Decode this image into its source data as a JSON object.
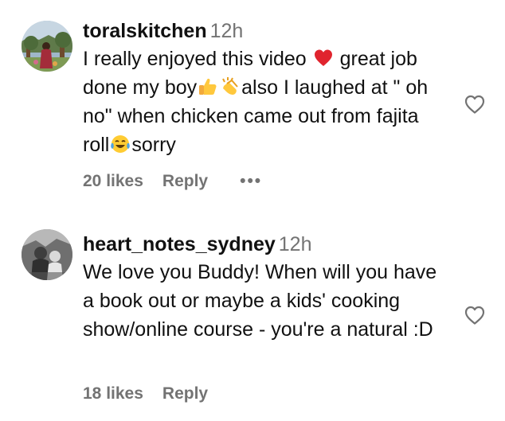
{
  "comments": [
    {
      "username": "toralskitchen",
      "time": "12h",
      "text_parts": [
        "I really enjoyed this video ",
        " great job done my boy",
        "",
        "also I laughed at \" oh no\" when chicken came out from fajita roll",
        "sorry"
      ],
      "likes": "20 likes",
      "reply": "Reply",
      "more": "•••"
    },
    {
      "username": "heart_notes_sydney",
      "time": "12h",
      "text": "We love you Buddy! When will you have a book out or maybe a kids' cooking show/online course - you're a natural :D",
      "likes": "18 likes",
      "reply": "Reply"
    }
  ],
  "icons": {
    "like": "heart-outline-icon",
    "emoji_1": "red-heart-emoji",
    "emoji_2": "thumbs-up-emoji",
    "emoji_3": "clapping-hands-emoji",
    "emoji_4": "tears-of-joy-emoji"
  },
  "colors": {
    "text": "#111111",
    "secondary": "#737373",
    "heart": "#e0245e"
  }
}
